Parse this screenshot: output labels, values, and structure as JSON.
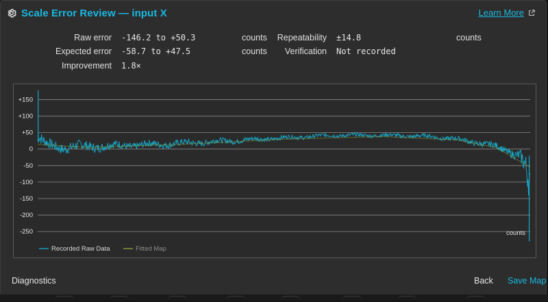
{
  "dialog": {
    "title": "Scale Error Review — input X",
    "learn_more": "Learn More"
  },
  "stats": {
    "raw_error": {
      "label": "Raw error",
      "value": "-146.2 to +50.3",
      "unit": "counts"
    },
    "expected_error": {
      "label": "Expected error",
      "value": "-58.7 to +47.5",
      "unit": "counts"
    },
    "improvement": {
      "label": "Improvement",
      "value": "1.8×"
    },
    "repeatability": {
      "label": "Repeatability",
      "value": "±14.8",
      "unit": "counts"
    },
    "verification": {
      "label": "Verification",
      "value": "Not recorded"
    }
  },
  "chart_data": {
    "type": "line",
    "ylabel": "counts",
    "yticks": [
      "+150",
      "+100",
      "+50",
      "0",
      "-50",
      "-100",
      "-150",
      "-200",
      "-250"
    ],
    "ytick_values": [
      150,
      100,
      50,
      0,
      -50,
      -100,
      -150,
      -200,
      -250
    ],
    "ylim": [
      -285,
      180
    ],
    "grid": true,
    "legend_placement": "bottom-left",
    "series": [
      {
        "name": "Recorded Raw Data",
        "color": "#17a9c8",
        "x": [
          0,
          0.01,
          0.02,
          0.05,
          0.1,
          0.2,
          0.3,
          0.4,
          0.5,
          0.6,
          0.7,
          0.8,
          0.85,
          0.9,
          0.93,
          0.96,
          0.98,
          0.99,
          1.0
        ],
        "center": [
          40,
          22,
          12,
          6,
          8,
          12,
          18,
          26,
          34,
          42,
          42,
          38,
          30,
          18,
          8,
          -8,
          -20,
          -60,
          -140
        ],
        "spread": [
          25,
          22,
          20,
          20,
          18,
          14,
          12,
          10,
          8,
          7,
          7,
          8,
          9,
          11,
          12,
          15,
          22,
          45,
          70
        ]
      },
      {
        "name": "Fitted Map",
        "color": "#8aa03a",
        "x": [
          0,
          0.1,
          0.3,
          0.5,
          0.7,
          0.85,
          0.93,
          1.0
        ],
        "y": [
          15,
          5,
          15,
          30,
          38,
          28,
          5,
          -55
        ]
      }
    ]
  },
  "footer": {
    "diagnostics": "Diagnostics",
    "back": "Back",
    "save_map": "Save Map"
  }
}
